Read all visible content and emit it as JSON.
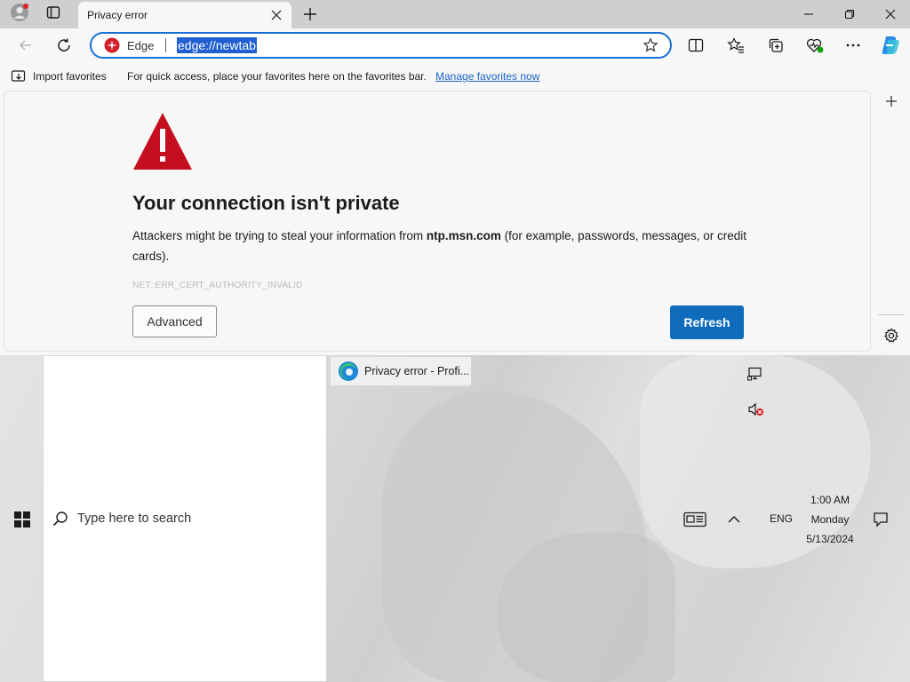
{
  "browser": {
    "tab": {
      "title": "Privacy error"
    },
    "addressbar": {
      "chip_label": "Edge",
      "url": "edge://newtab"
    },
    "favorites_bar": {
      "import_label": "Import favorites",
      "message": "For quick access, place your favorites here on the favorites bar.",
      "manage_link": "Manage favorites now"
    }
  },
  "error_page": {
    "heading": "Your connection isn't private",
    "desc_before": "Attackers might be trying to steal your information from ",
    "domain": "ntp.msn.com",
    "desc_after": " (for example, passwords, messages, or credit cards).",
    "error_code": "NET::ERR_CERT_AUTHORITY_INVALID",
    "advanced_label": "Advanced",
    "refresh_label": "Refresh"
  },
  "taskbar": {
    "search_placeholder": "Type here to search",
    "edge_task_label": "Privacy error - Profi...",
    "language": "ENG",
    "time": "1:00 AM",
    "day": "Monday",
    "date": "5/13/2024"
  },
  "colors": {
    "accent": "#0f6cbd",
    "link": "#1a62c8",
    "warning_red": "#c50f1f",
    "url_selection": "#1f5fd1"
  },
  "icons": [
    "profile-icon",
    "tab-actions-icon",
    "close-icon",
    "plus-icon",
    "minimize-icon",
    "restore-icon",
    "back-icon",
    "reload-icon",
    "edge-logo-icon",
    "star-icon",
    "split-screen-icon",
    "favorites-icon",
    "collections-icon",
    "browser-essentials-icon",
    "more-icon",
    "copilot-icon",
    "import-icon",
    "warning-icon",
    "settings-icon",
    "windows-start-icon",
    "search-icon",
    "network-icon",
    "volume-muted-icon",
    "news-icon",
    "chevron-up-icon",
    "notification-icon"
  ]
}
